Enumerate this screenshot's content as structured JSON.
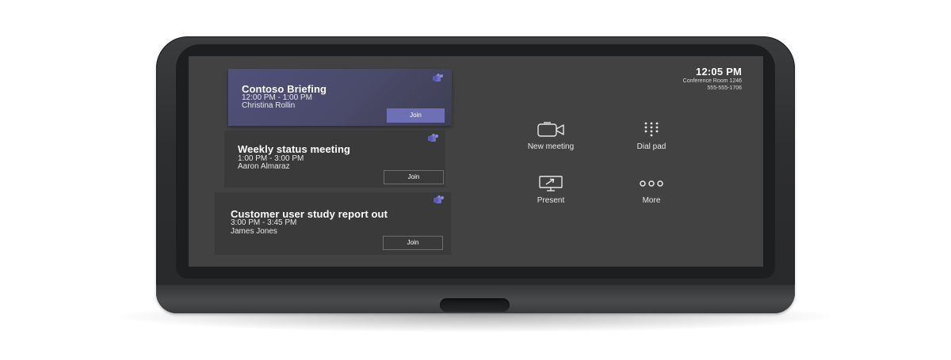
{
  "status": {
    "time": "12:05 PM",
    "room": "Conference Room 1246",
    "phone": "555-555-1706"
  },
  "meetings": [
    {
      "title": "Contoso Briefing",
      "time": "12:00 PM - 1:00 PM",
      "organizer": "Christina Rollin",
      "join_label": "Join",
      "icon": "teams-icon"
    },
    {
      "title": "Weekly status meeting",
      "time": "1:00 PM - 3:00 PM",
      "organizer": "Aaron Almaraz",
      "join_label": "Join",
      "icon": "teams-icon"
    },
    {
      "title": "Customer user study report out",
      "time": "3:00 PM - 3:45 PM",
      "organizer": "James Jones",
      "join_label": "Join",
      "icon": "teams-icon"
    }
  ],
  "actions": [
    {
      "label": "New meeting",
      "icon": "video-camera-icon"
    },
    {
      "label": "Dial pad",
      "icon": "dial-pad-icon"
    },
    {
      "label": "Present",
      "icon": "present-screen-icon"
    },
    {
      "label": "More",
      "icon": "more-dots-icon"
    }
  ],
  "colors": {
    "accent": "#6f6fb5",
    "screen_background": "#424242",
    "card_background": "#3a3a3a",
    "active_card": "#4a4a6a"
  }
}
